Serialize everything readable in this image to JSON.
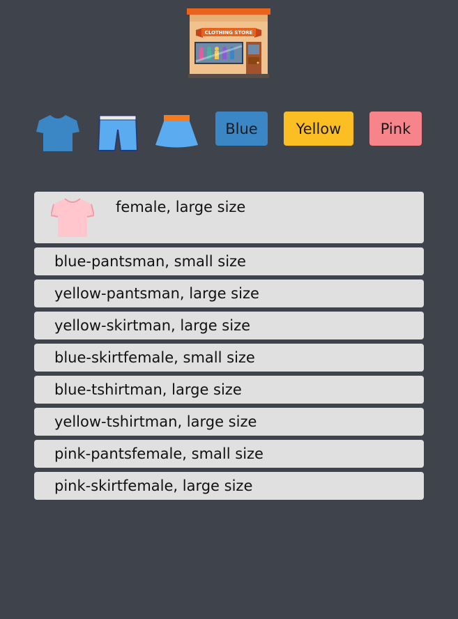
{
  "header": {
    "logo_icon": "clothing-store-icon",
    "logo_text": "CLOTHING STORE"
  },
  "filters": {
    "types": [
      {
        "icon": "tshirt-icon",
        "color": "#3b86c4"
      },
      {
        "icon": "pants-icon",
        "color": "#5aabf0"
      },
      {
        "icon": "skirt-icon",
        "color": "#5aabf0"
      }
    ],
    "colors": [
      {
        "label": "Blue",
        "color": "#3b86c4"
      },
      {
        "label": "Yellow",
        "color": "#fbbf24"
      },
      {
        "label": "Pink",
        "color": "#f7838b"
      }
    ]
  },
  "items": {
    "featured": {
      "label": "female, large size",
      "icon": "pink-tshirt-icon",
      "icon_color": "#ffc6cd"
    },
    "rows": [
      "blue-pantsman, small size",
      "yellow-pantsman, large size",
      "yellow-skirtman, large size",
      "blue-skirtfemale, small size",
      "blue-tshirtman, large size",
      "yellow-tshirtman, large size",
      "pink-pantsfemale, small size",
      "pink-skirtfemale, large size"
    ]
  }
}
